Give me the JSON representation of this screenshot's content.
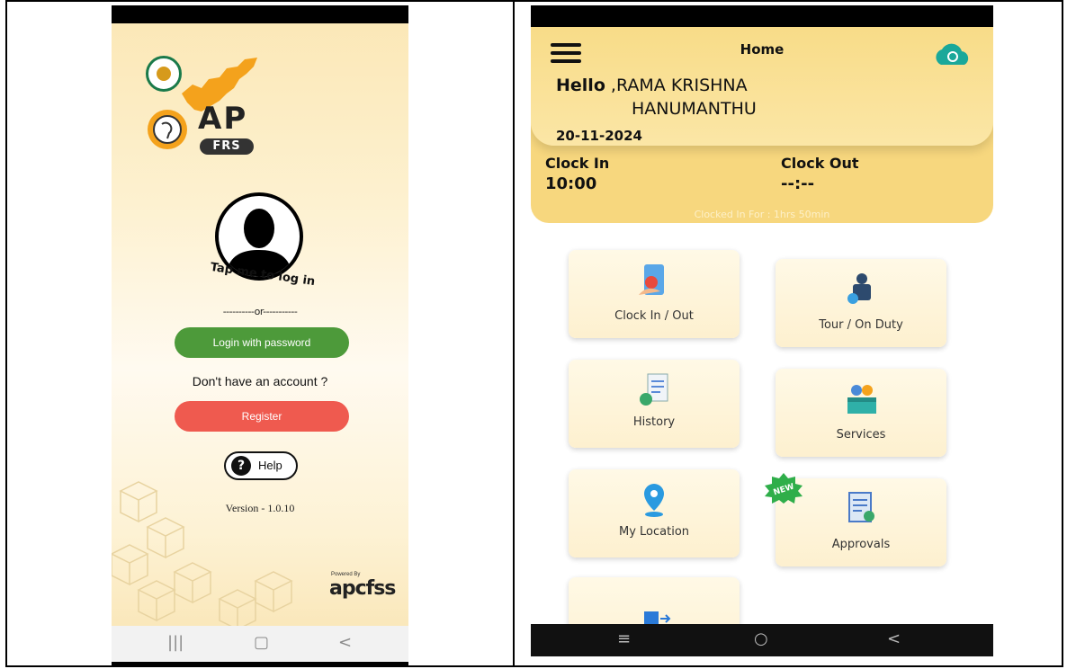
{
  "login_screen": {
    "logo_text": "AP",
    "logo_sub": "FRS",
    "tap_prompt": "Tap me to log in",
    "divider": "----------or-----------",
    "login_button": "Login with password",
    "no_account": "Don't have an account ?",
    "register_button": "Register",
    "help_button": "Help",
    "help_icon_glyph": "?",
    "version": "Version - 1.0.10",
    "powered_by": "Powered By",
    "brand": "apcfss",
    "nav": {
      "recent": "|||",
      "home": "▢",
      "back": "<"
    }
  },
  "home_screen": {
    "title": "Home",
    "greeting": "Hello",
    "name_line1": ",RAMA KRISHNA",
    "name_line2": "HANUMANTHU",
    "date": "20-11-2024",
    "clock_in_label": "Clock In",
    "clock_in_value": "10:00",
    "clock_out_label": "Clock Out",
    "clock_out_value": "--:--",
    "clocked_in_for": "Clocked In For : 1hrs 50min",
    "tiles": [
      {
        "label": "Clock In / Out",
        "icon": "clock-in-out-icon"
      },
      {
        "label": "Tour / On Duty",
        "icon": "tour-duty-icon"
      },
      {
        "label": "History",
        "icon": "history-icon"
      },
      {
        "label": "Services",
        "icon": "services-icon"
      },
      {
        "label": "My Location",
        "icon": "location-pin-icon"
      },
      {
        "label": "Approvals",
        "icon": "approvals-icon"
      }
    ],
    "new_badge": "NEW",
    "nav": {
      "recent": "≡",
      "home": "○",
      "back": "<"
    }
  },
  "colors": {
    "login_green": "#4d9a3a",
    "register_red": "#ef5a4f",
    "header_yellow": "#f7d77e",
    "cloud_teal": "#1aa89a"
  }
}
